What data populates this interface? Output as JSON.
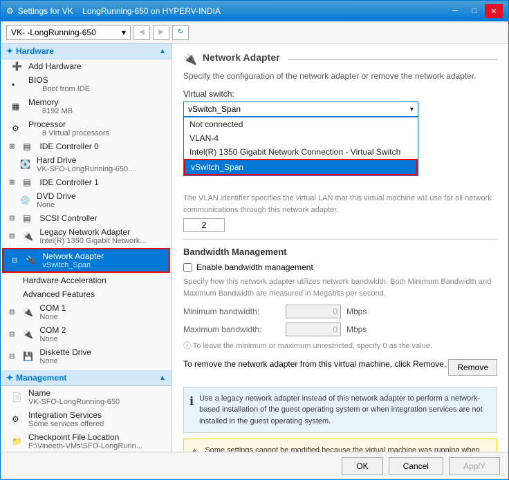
{
  "window": {
    "title_left": "Settings for VK",
    "title_right": "LongRunning-650 on HYPERV-INDIA",
    "icon": "⚙"
  },
  "titlebar": {
    "minimize_label": "─",
    "restore_label": "□",
    "close_label": "✕"
  },
  "toolbar": {
    "vm_selector": "VK-  -LongRunning-650",
    "back_arrow": "◀",
    "forward_arrow": "▶",
    "refresh_arrow": "↻"
  },
  "sidebar": {
    "hardware_label": "Hardware",
    "items": [
      {
        "id": "add-hardware",
        "label": "Add Hardware",
        "icon": "➕",
        "indent": 1
      },
      {
        "id": "bios",
        "label": "BIOS",
        "sublabel": "Boot from IDE",
        "icon": "💾",
        "indent": 1
      },
      {
        "id": "memory",
        "label": "Memory",
        "sublabel": "8192 MB",
        "icon": "▦",
        "indent": 1
      },
      {
        "id": "processor",
        "label": "Processor",
        "sublabel": "8 Virtual processors",
        "icon": "⚙",
        "indent": 1
      },
      {
        "id": "ide0",
        "label": "IDE Controller 0",
        "icon": "▤",
        "indent": 1
      },
      {
        "id": "hard-drive",
        "label": "Hard Drive",
        "sublabel": "VK-SFO-LongRunning-650....",
        "icon": "💽",
        "indent": 2
      },
      {
        "id": "ide1",
        "label": "IDE Controller 1",
        "icon": "▤",
        "indent": 1
      },
      {
        "id": "dvd-drive",
        "label": "DVD Drive",
        "sublabel": "None",
        "icon": "💿",
        "indent": 2
      },
      {
        "id": "scsi",
        "label": "SCSI Controller",
        "icon": "▤",
        "indent": 1
      },
      {
        "id": "legacy-nic",
        "label": "Legacy Network Adapter",
        "sublabel": "Intel(R) 1350 Gigabit Network...",
        "icon": "🔌",
        "indent": 1
      },
      {
        "id": "network-adapter",
        "label": "Network Adapter",
        "sublabel": "vSwitch_Span",
        "icon": "🔌",
        "indent": 1,
        "selected": true
      },
      {
        "id": "hw-accel",
        "label": "Hardware Acceleration",
        "icon": "",
        "indent": 2
      },
      {
        "id": "adv-features",
        "label": "Advanced Features",
        "icon": "",
        "indent": 2
      },
      {
        "id": "com1",
        "label": "COM 1",
        "sublabel": "None",
        "icon": "🔌",
        "indent": 1
      },
      {
        "id": "com2",
        "label": "COM 2",
        "sublabel": "None",
        "icon": "🔌",
        "indent": 1
      },
      {
        "id": "diskette",
        "label": "Diskette Drive",
        "sublabel": "None",
        "icon": "💾",
        "indent": 1
      }
    ],
    "management_label": "Management",
    "mgmt_items": [
      {
        "id": "name",
        "label": "Name",
        "sublabel": "VK-SFO-LongRunning-650",
        "icon": "📄"
      },
      {
        "id": "integration",
        "label": "Integration Services",
        "sublabel": "Some services offered",
        "icon": "⚙"
      },
      {
        "id": "checkpoint",
        "label": "Checkpoint File Location",
        "sublabel": "F:\\Vineeth-VMs\\SFO-LongRunn...",
        "icon": "📁"
      }
    ]
  },
  "content": {
    "section_title": "Network Adapter",
    "description": "Specify the configuration of the network adapter or remove the network adapter.",
    "virtual_switch_label": "Virtual switch:",
    "dropdown_value": "vSwitch_Span",
    "dropdown_options": [
      {
        "label": "Not connected",
        "selected": false
      },
      {
        "label": "VLAN-4",
        "selected": false
      },
      {
        "label": "Intel(R) 1350 Gigabit Network Connection - Virtual Switch",
        "selected": false
      },
      {
        "label": "vSwitch_Span",
        "selected": true
      }
    ],
    "vlan_hint": "The VLAN identifier specifies the virtual LAN that this virtual machine will use for all network communications through this network adapter.",
    "vlan_value": "2",
    "bandwidth_header": "Bandwidth Management",
    "bandwidth_checkbox_label": "Enable bandwidth management",
    "bandwidth_desc": "Specify how this network adapter utilizes network bandwidth. Both Minimum Bandwidth and Maximum Bandwidth are measured in Megabits per second.",
    "min_bandwidth_label": "Minimum bandwidth:",
    "min_bandwidth_value": "0",
    "min_bandwidth_unit": "Mbps",
    "max_bandwidth_label": "Maximum bandwidth:",
    "max_bandwidth_value": "0",
    "max_bandwidth_unit": "Mbps",
    "bandwidth_hint": "ⓘ  To leave the minimum or maximum unrestricted, specify 0 as the value.",
    "remove_notice": "To remove the network adapter from this virtual machine, click Remove.",
    "remove_btn": "Remove",
    "notice1": "Use a legacy network adapter instead of this network adapter to perform a network-based installation of the guest operating system or when integration services are not installed in the guest operating system.",
    "notice2": "Some settings cannot be modified because the virtual machine was running when this window was opened. To modify a setting that is unavailable, shut down the virtual machine and then reopen this window.",
    "ok_btn": "OK",
    "cancel_btn": "Cancel",
    "apply_btn": "ApplY"
  }
}
